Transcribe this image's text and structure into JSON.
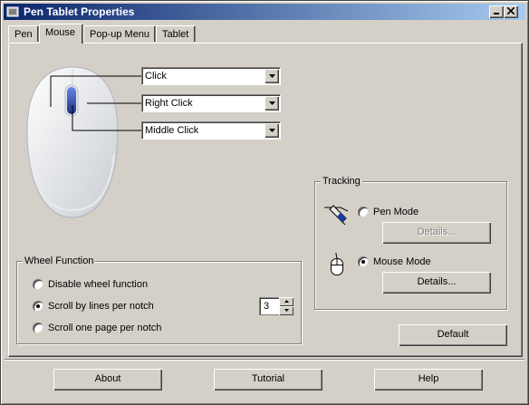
{
  "window": {
    "title": "Pen Tablet Properties"
  },
  "tabs": [
    {
      "label": "Pen"
    },
    {
      "label": "Mouse"
    },
    {
      "label": "Pop-up Menu"
    },
    {
      "label": "Tablet"
    }
  ],
  "active_tab": "Mouse",
  "buttons_map": {
    "left_button": "Click",
    "right_button": "Right Click",
    "middle_button": "Middle Click"
  },
  "tracking": {
    "legend": "Tracking",
    "pen_mode_label": "Pen Mode",
    "pen_details_label": "Details...",
    "mouse_mode_label": "Mouse Mode",
    "mouse_details_label": "Details...",
    "selected": "Mouse Mode"
  },
  "wheel": {
    "legend": "Wheel Function",
    "options": [
      "Disable wheel function",
      "Scroll by lines per notch",
      "Scroll one page per notch"
    ],
    "selected": "Scroll by lines per notch",
    "lines_per_notch": "3"
  },
  "default_label": "Default",
  "bottom": {
    "about_label": "About",
    "tutorial_label": "Tutorial",
    "help_label": "Help"
  },
  "colors": {
    "titlebar_start": "#0a246a",
    "titlebar_end": "#a6caf0",
    "face": "#d4d0c8",
    "mouse_wheel": "#2a46a8"
  },
  "icons": [
    "app-icon",
    "minimize-icon",
    "maximize-icon",
    "close-icon",
    "pen-icon",
    "mouse-icon",
    "dropdown-arrow-icon",
    "spin-up-icon",
    "spin-down-icon"
  ]
}
